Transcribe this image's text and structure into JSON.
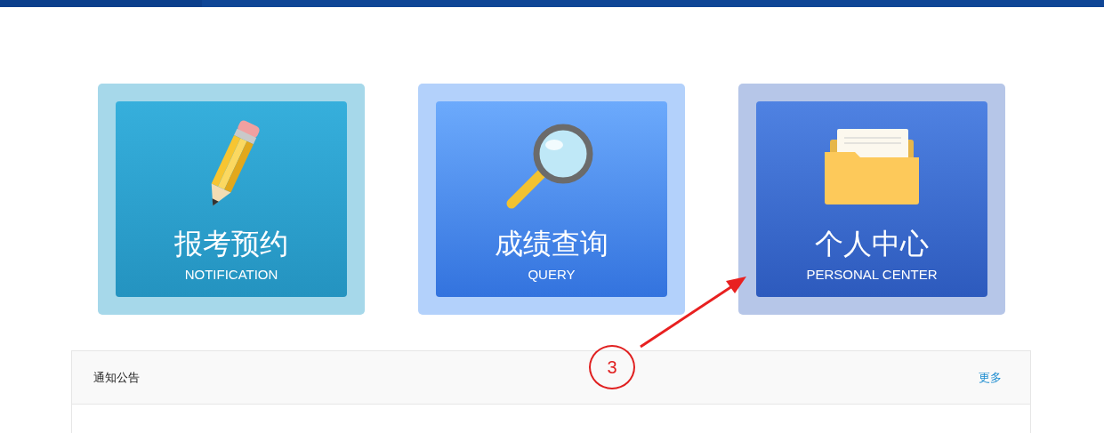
{
  "cards": [
    {
      "title": "报考预约",
      "subtitle": "NOTIFICATION"
    },
    {
      "title": "成绩查询",
      "subtitle": "QUERY"
    },
    {
      "title": "个人中心",
      "subtitle": "PERSONAL CENTER"
    }
  ],
  "notice_panel": {
    "title": "通知公告",
    "more_link": "更多"
  },
  "annotation": {
    "label": "3"
  }
}
